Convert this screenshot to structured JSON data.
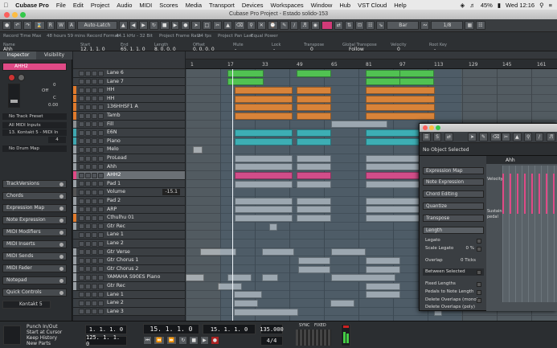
{
  "menubar": {
    "app": "Cubase Pro",
    "items": [
      "File",
      "Edit",
      "Project",
      "Audio",
      "MIDI",
      "Scores",
      "Media",
      "Transport",
      "Devices",
      "Workspaces",
      "Window",
      "Hub",
      "VST Cloud",
      "Help"
    ],
    "battery": "45%",
    "clock": "Wed 12:16"
  },
  "window": {
    "title": "Cubase Pro Project - Estado solido-153"
  },
  "toolbar": {
    "mode_buttons": [
      "R",
      "W",
      "A"
    ],
    "automation": "Auto-Latch",
    "grid_type": "Bar",
    "quantize": "1/8"
  },
  "infoline": {
    "headers": [
      "Record Time Max",
      "Record Format",
      "Project Frame Rate",
      "Project Pan Law"
    ],
    "values": [
      "48 hours 59 mins",
      "44.1 kHz - 32 Bit",
      "24 fps",
      "Equal Power"
    ],
    "event_headers": [
      "Name",
      "Start",
      "End",
      "Length",
      "Offset",
      "Mute",
      "Lock",
      "Transpose",
      "Global Transpose",
      "Velocity",
      "Root Key"
    ],
    "event_values": [
      "Ahh",
      "12. 1. 1. 0",
      "65. 1. 1. 0",
      "8. 0. 0. 0",
      "0. 0. 0. 0",
      "-",
      "-",
      "0",
      "Follow",
      "0",
      "-"
    ]
  },
  "inspector": {
    "tabs": [
      "Inspector",
      "Visibility"
    ],
    "track_name": "AHH2",
    "volume_val": "0",
    "pan_val": "C",
    "delay_val": "0.00",
    "off_label": "Off",
    "track_preset": "No Track Preset",
    "midi_in": "All MIDI Inputs",
    "midi_out": "13. Kontakt 5 - MIDI In",
    "channel": "4",
    "drum_map": "No Drum Map",
    "sections": [
      "TrackVersions",
      "Chords",
      "Expression Map",
      "Note Expression",
      "MIDI Modifiers",
      "MIDI Inserts",
      "MIDI Sends",
      "MIDI Fader",
      "Notepad",
      "Quick Controls"
    ],
    "bottom_instrument": "Kontakt 5"
  },
  "tracks": [
    {
      "name": "Lane 6",
      "color": "#3a3f44"
    },
    {
      "name": "Lane 7",
      "color": "#3a3f44"
    },
    {
      "name": "HH",
      "color": "#e07a2c"
    },
    {
      "name": "HH",
      "color": "#e07a2c"
    },
    {
      "name": "136HHSF1 A",
      "color": "#e07a2c"
    },
    {
      "name": "Tamb",
      "color": "#e07a2c"
    },
    {
      "name": "Fill",
      "color": "#8c8f92"
    },
    {
      "name": "E6N",
      "color": "#3fa7b0"
    },
    {
      "name": "Piano",
      "color": "#3fa7b0"
    },
    {
      "name": "Melo",
      "color": "#9aa0a5"
    },
    {
      "name": "ProLead",
      "color": "#9aa0a5"
    },
    {
      "name": "Ahh",
      "color": "#9aa0a5"
    },
    {
      "name": "AHH2",
      "color": "#e04a86"
    },
    {
      "name": "Pad 1",
      "color": "#9aa0a5"
    },
    {
      "name": "Volume",
      "color": "#555"
    },
    {
      "name": "Pad 2",
      "color": "#9aa0a5"
    },
    {
      "name": "ARP",
      "color": "#9aa0a5"
    },
    {
      "name": "Cthulhu 01",
      "color": "#e07a2c"
    },
    {
      "name": "Gtr Rec",
      "color": "#9aa0a5"
    },
    {
      "name": "Lane 1",
      "color": "#3a3f44"
    },
    {
      "name": "Lane 2",
      "color": "#3a3f44"
    },
    {
      "name": "Gtr Verse",
      "color": "#9aa0a5"
    },
    {
      "name": "Gtr Chorus 1",
      "color": "#9aa0a5"
    },
    {
      "name": "Gtr Chorus 2",
      "color": "#9aa0a5"
    },
    {
      "name": "YAMAHA S90ES Piano",
      "color": "#9aa0a5"
    },
    {
      "name": "Gtr Rec",
      "color": "#9aa0a5"
    },
    {
      "name": "Lane 1",
      "color": "#3a3f44"
    },
    {
      "name": "Lane 2",
      "color": "#3a3f44"
    },
    {
      "name": "Lane 3",
      "color": "#3a3f44"
    }
  ],
  "volume_lane_value": "-15.1",
  "ruler": {
    "marks": [
      "1",
      "17",
      "33",
      "49",
      "65",
      "81",
      "97",
      "113",
      "129",
      "145",
      "161"
    ]
  },
  "transport": {
    "punch_in_out": "Punch In/Out",
    "start_at_cursor": "Start at Cursor",
    "keep_history": "Keep History",
    "new_parts": "New Parts",
    "left_locator": "1. 1. 1. 0",
    "right_locator": "125. 1. 1. 0",
    "position_primary": "15. 1. 1. 0",
    "position_secondary": "15. 1. 1. 0",
    "tempo": "135.000",
    "signature": "4/4",
    "sync_label": "SYNC",
    "fixed_label": "FIXED"
  },
  "editor": {
    "info": "No Object Selected",
    "part_name": "Ahh",
    "lane_label": "Velocity",
    "sustain_label": "Sustain",
    "pedal_label": "pedal",
    "sections": [
      "Expression Map",
      "Note Expression",
      "Chord Editing",
      "Quantize",
      "Transpose",
      "Length"
    ],
    "length_rows": [
      "Legato",
      "Scale Legato",
      "Overlap",
      "Between Selected",
      "Fixed Lengths",
      "Pedals to Note Length",
      "Delete Overlaps (mono)",
      "Delete Overlaps (poly)"
    ],
    "scale_legato_val": "0 %",
    "overlap_val": "0 Ticks"
  },
  "colors": {
    "accent": "#e04a86",
    "green": "#55c94a",
    "orange": "#e8852f",
    "teal": "#3fb3b5",
    "gray": "#a6acb0"
  }
}
